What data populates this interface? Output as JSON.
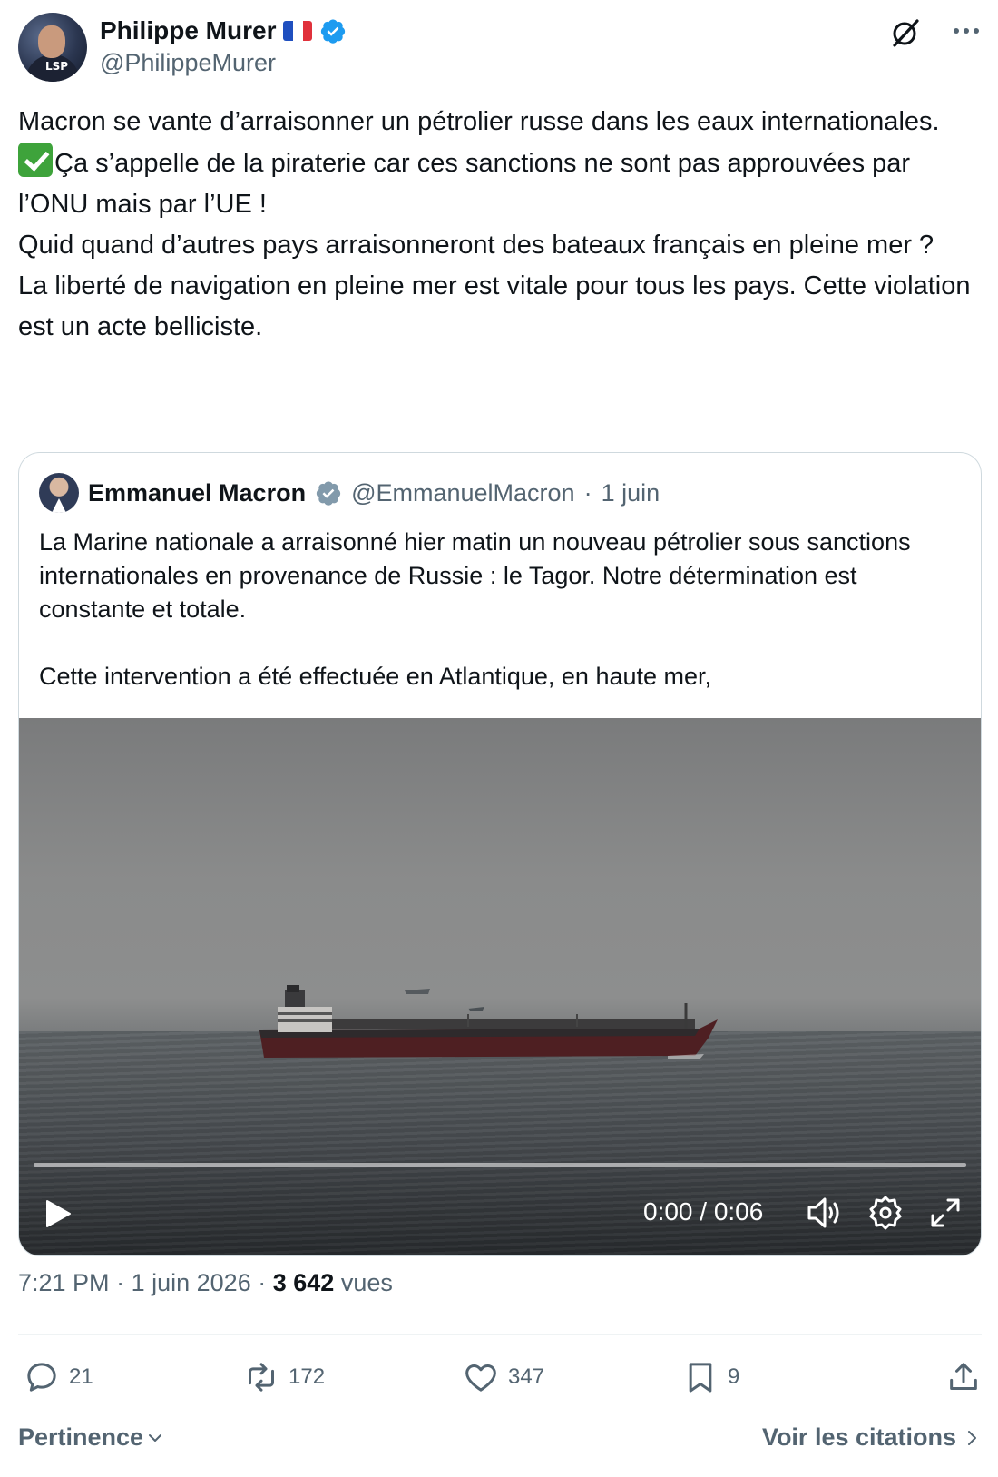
{
  "author": {
    "display_name": "Philippe Murer",
    "handle": "@PhilippeMurer",
    "avatar_tag": "LSP"
  },
  "tweet": {
    "line1": "Macron se vante d’arraisonner un pétrolier russe dans les eaux internationales.",
    "line2": "Ça s’appelle de la piraterie car ces sanctions ne sont pas approuvées par l’ONU mais par l’UE !",
    "line3": "Quid quand d’autres pays arraisonneront des bateaux français en pleine mer ?",
    "line4": "La liberté de navigation en pleine mer est vitale pour tous les pays. Cette violation est un acte belliciste."
  },
  "quote": {
    "display_name": "Emmanuel Macron",
    "handle": "@EmmanuelMacron",
    "separator": "·",
    "date": "1 juin",
    "text": "La Marine nationale a arraisonné hier matin un nouveau pétrolier sous sanctions internationales en provenance de Russie : le Tagor. Notre détermination est constante et totale.\n\nCette intervention a été effectuée en Atlantique, en haute mer,",
    "video": {
      "time": "0:00 / 0:06",
      "progress": 0
    }
  },
  "meta": {
    "time": "7:21 PM",
    "separator": "·",
    "date": "1 juin 2026",
    "views_count": "3 642",
    "views_label": "vues"
  },
  "actions": {
    "replies": "21",
    "reposts": "172",
    "likes": "347",
    "bookmarks": "9"
  },
  "footer": {
    "sort_label": "Pertinence",
    "quotes_label": "Voir les citations"
  },
  "colors": {
    "verified": "#1d9bf0",
    "secondary_text": "#536471",
    "primary_text": "#0f1419",
    "border": "#cfd9de"
  },
  "icons": [
    "verified-badge-icon",
    "france-flag-icon",
    "grok-icon",
    "more-icon",
    "play-icon",
    "volume-icon",
    "settings-icon",
    "fullscreen-icon",
    "reply-icon",
    "repost-icon",
    "like-icon",
    "bookmark-icon",
    "share-icon",
    "chevron-down-icon",
    "chevron-right-icon"
  ]
}
